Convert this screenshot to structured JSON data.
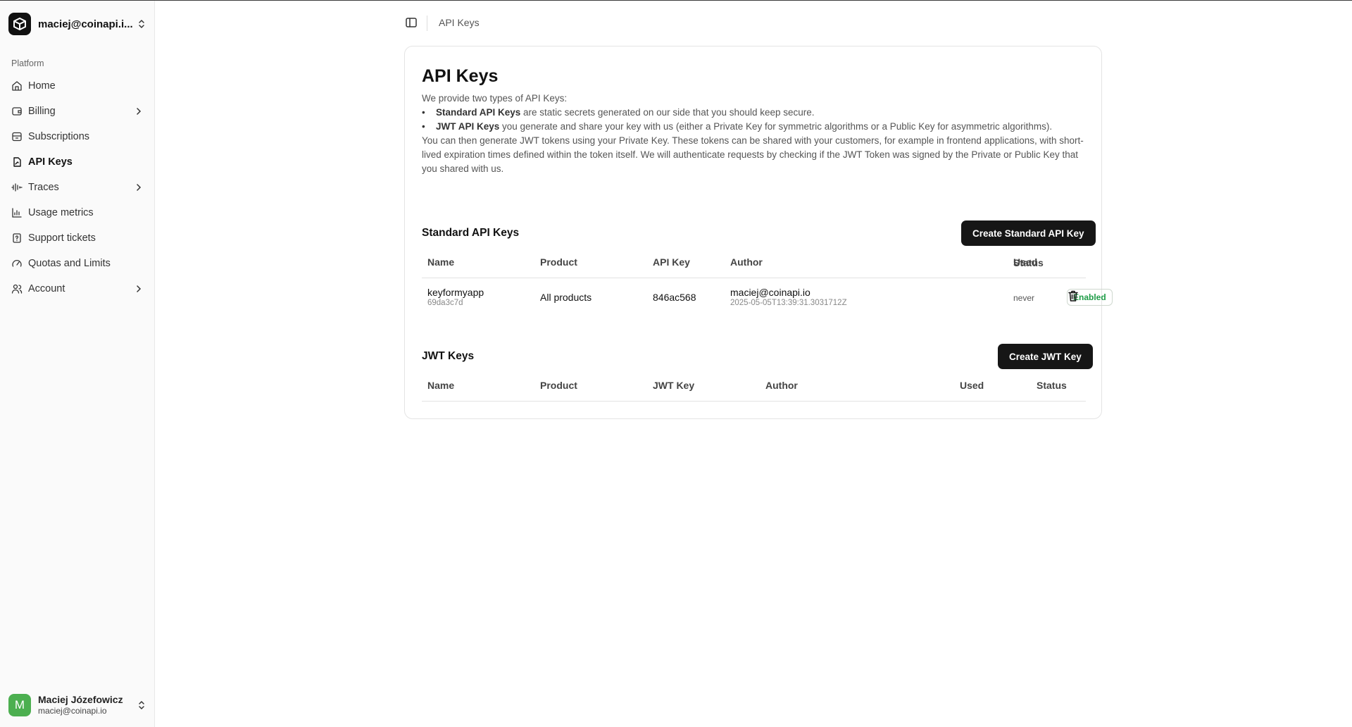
{
  "org": {
    "name": "maciej@coinapi.i..."
  },
  "sidebar": {
    "section_label": "Platform",
    "items": [
      {
        "label": "Home",
        "icon": "home-icon"
      },
      {
        "label": "Billing",
        "icon": "wallet-icon",
        "has_submenu": true
      },
      {
        "label": "Subscriptions",
        "icon": "archive-icon"
      },
      {
        "label": "API Keys",
        "icon": "key-document-icon",
        "active": true
      },
      {
        "label": "Traces",
        "icon": "wave-icon",
        "has_submenu": true
      },
      {
        "label": "Usage metrics",
        "icon": "bar-chart-icon"
      },
      {
        "label": "Support tickets",
        "icon": "help-document-icon"
      },
      {
        "label": "Quotas and Limits",
        "icon": "gauge-icon"
      },
      {
        "label": "Account",
        "icon": "users-icon",
        "has_submenu": true
      }
    ]
  },
  "user": {
    "initial": "M",
    "name": "Maciej Józefowicz",
    "email": "maciej@coinapi.io",
    "avatar_color": "#4caf50"
  },
  "breadcrumb": {
    "current": "API Keys"
  },
  "page": {
    "title": "API Keys",
    "intro": "We provide two types of API Keys:",
    "bullet1_bold": "Standard API Keys",
    "bullet1_rest": " are static secrets generated on our side that you should keep secure.",
    "bullet2_bold": "JWT API Keys",
    "bullet2_rest": " you generate and share your key with us (either a Private Key for symmetric algorithms or a Public Key for asymmetric algorithms).",
    "paragraph": "You can then generate JWT tokens using your Private Key. These tokens can be shared with your customers, for example in frontend applications, with short-lived expiration times defined within the token itself. We will authenticate requests by checking if the JWT Token was signed by the Private or Public Key that you shared with us."
  },
  "standard": {
    "title": "Standard API Keys",
    "create_label": "Create Standard API Key",
    "columns": [
      "Name",
      "Product",
      "API Key",
      "Author",
      "Used",
      "Status"
    ],
    "rows": [
      {
        "name": "keyformyapp",
        "id": "69da3c7d",
        "product": "All products",
        "api_key": "846ac568",
        "author": "maciej@coinapi.io",
        "created": "2025-05-05T13:39:31.3031712Z",
        "used": "never",
        "status": "Enabled"
      }
    ]
  },
  "jwt": {
    "title": "JWT Keys",
    "create_label": "Create JWT Key",
    "columns": [
      "Name",
      "Product",
      "JWT Key",
      "Author",
      "Used",
      "Status"
    ]
  },
  "colors": {
    "accent_dark": "#161616",
    "status_enabled": "#1e9c47"
  }
}
